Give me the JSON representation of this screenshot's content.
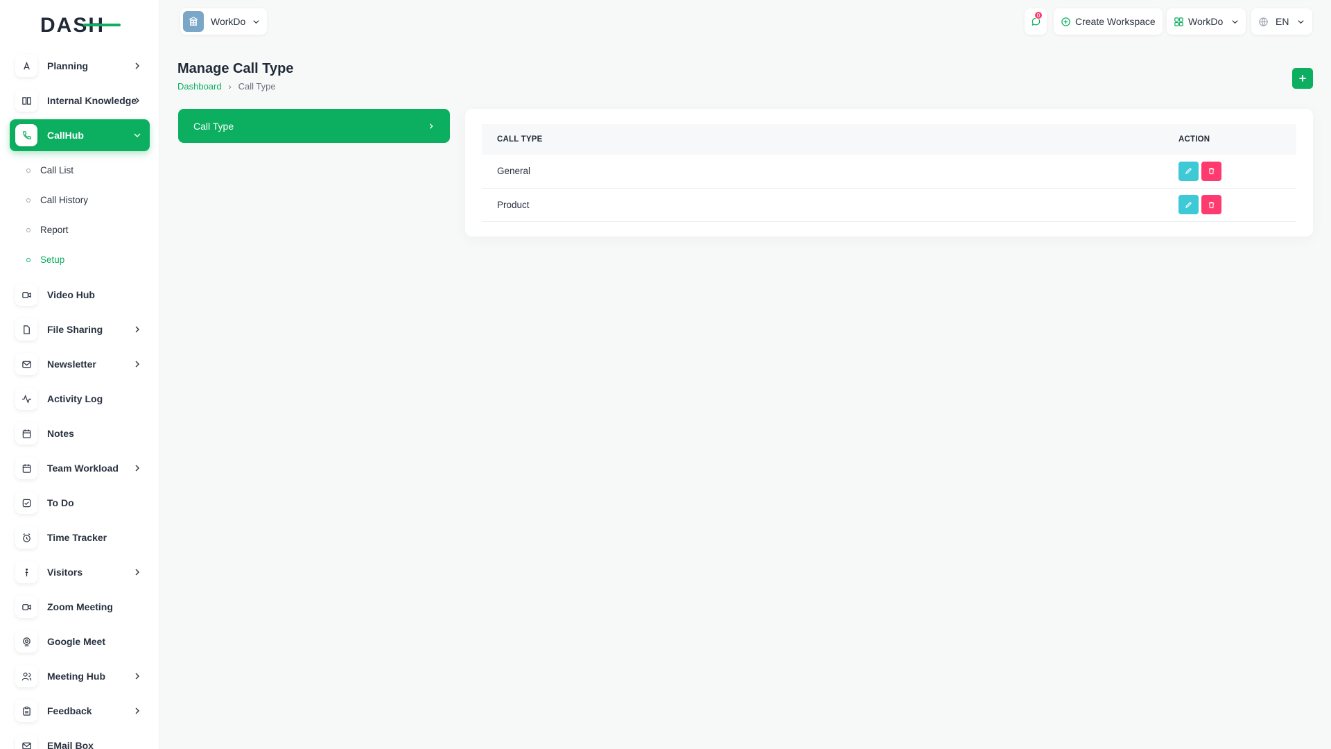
{
  "brand": {
    "logo_text": "DASH",
    "accent": "#0caf60"
  },
  "sidebar": {
    "items": [
      {
        "label": "Planning",
        "icon": "planning-icon",
        "has_children": true
      },
      {
        "label": "Internal Knowledge",
        "icon": "book-icon",
        "has_children": true
      },
      {
        "label": "CallHub",
        "icon": "phone-icon",
        "has_children": true,
        "active": true,
        "children": [
          {
            "label": "Call List"
          },
          {
            "label": "Call History"
          },
          {
            "label": "Report"
          },
          {
            "label": "Setup",
            "current": true
          }
        ]
      },
      {
        "label": "Video Hub",
        "icon": "video-icon",
        "has_children": false
      },
      {
        "label": "File Sharing",
        "icon": "file-icon",
        "has_children": true
      },
      {
        "label": "Newsletter",
        "icon": "mail-icon",
        "has_children": true
      },
      {
        "label": "Activity Log",
        "icon": "activity-icon",
        "has_children": false
      },
      {
        "label": "Notes",
        "icon": "notes-icon",
        "has_children": false
      },
      {
        "label": "Team Workload",
        "icon": "calendar-icon",
        "has_children": true
      },
      {
        "label": "To Do",
        "icon": "checkbox-icon",
        "has_children": false
      },
      {
        "label": "Time Tracker",
        "icon": "clock-icon",
        "has_children": false
      },
      {
        "label": "Visitors",
        "icon": "person-icon",
        "has_children": true
      },
      {
        "label": "Zoom Meeting",
        "icon": "video-icon",
        "has_children": false
      },
      {
        "label": "Google Meet",
        "icon": "webcam-icon",
        "has_children": false
      },
      {
        "label": "Meeting Hub",
        "icon": "users-icon",
        "has_children": true
      },
      {
        "label": "Feedback",
        "icon": "clipboard-icon",
        "has_children": true
      },
      {
        "label": "EMail Box",
        "icon": "mail-icon",
        "has_children": false
      }
    ]
  },
  "header": {
    "workspace_name": "WorkDo",
    "notification_count": "0",
    "create_workspace_label": "Create Workspace",
    "workspace_menu_label": "WorkDo",
    "language": "EN"
  },
  "page": {
    "title": "Manage Call Type",
    "breadcrumb_home": "Dashboard",
    "breadcrumb_current": "Call Type",
    "setup_menu_label": "Call Type"
  },
  "table": {
    "headers": [
      "CALL TYPE",
      "ACTION"
    ],
    "rows": [
      {
        "call_type": "General"
      },
      {
        "call_type": "Product"
      }
    ]
  }
}
